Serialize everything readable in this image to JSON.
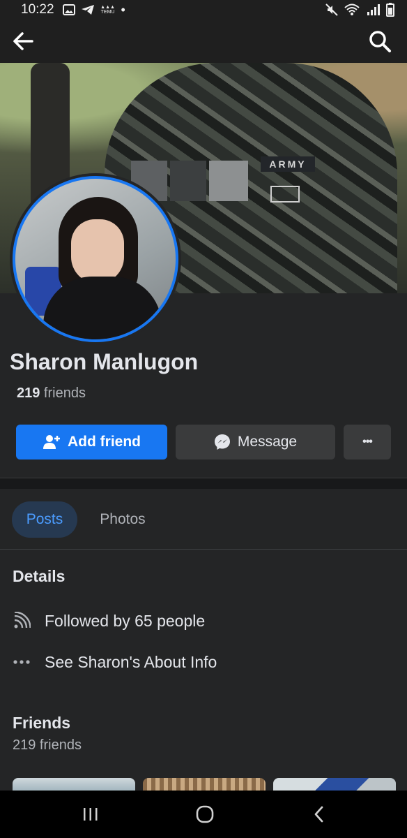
{
  "status_bar": {
    "time": "10:22",
    "temu_label": "TEMU",
    "dot": "•",
    "left_icons": [
      "image-icon",
      "telegram-icon",
      "temu-icon",
      "dot"
    ],
    "right_icons": [
      "mute-icon",
      "wifi-icon",
      "signal-icon",
      "battery-icon"
    ]
  },
  "top_bar": {
    "back_icon": "arrow-left-icon",
    "search_icon": "search-icon"
  },
  "cover": {
    "patch_text": "ARMY"
  },
  "profile": {
    "name": "Sharon Manlugon",
    "friends_number": "219",
    "friends_word": " friends"
  },
  "actions": {
    "add_friend_label": "Add friend",
    "message_label": "Message",
    "more_label": "•••"
  },
  "tabs": [
    {
      "label": "Posts",
      "active": true
    },
    {
      "label": "Photos",
      "active": false
    }
  ],
  "details": {
    "title": "Details",
    "items": [
      {
        "icon": "rss-feed-icon",
        "text": "Followed by 65 people"
      },
      {
        "icon": "more-dots-icon",
        "text": "See Sharon's About Info"
      }
    ]
  },
  "friends_section": {
    "title": "Friends",
    "subtitle": "219 friends"
  },
  "colors": {
    "background": "#242526",
    "accent": "#1877f2",
    "active_tab_text": "#4b9cff",
    "secondary_button": "#3a3b3c"
  },
  "nav_bar": {
    "icons": [
      "recents-icon",
      "home-icon",
      "back-icon"
    ]
  }
}
